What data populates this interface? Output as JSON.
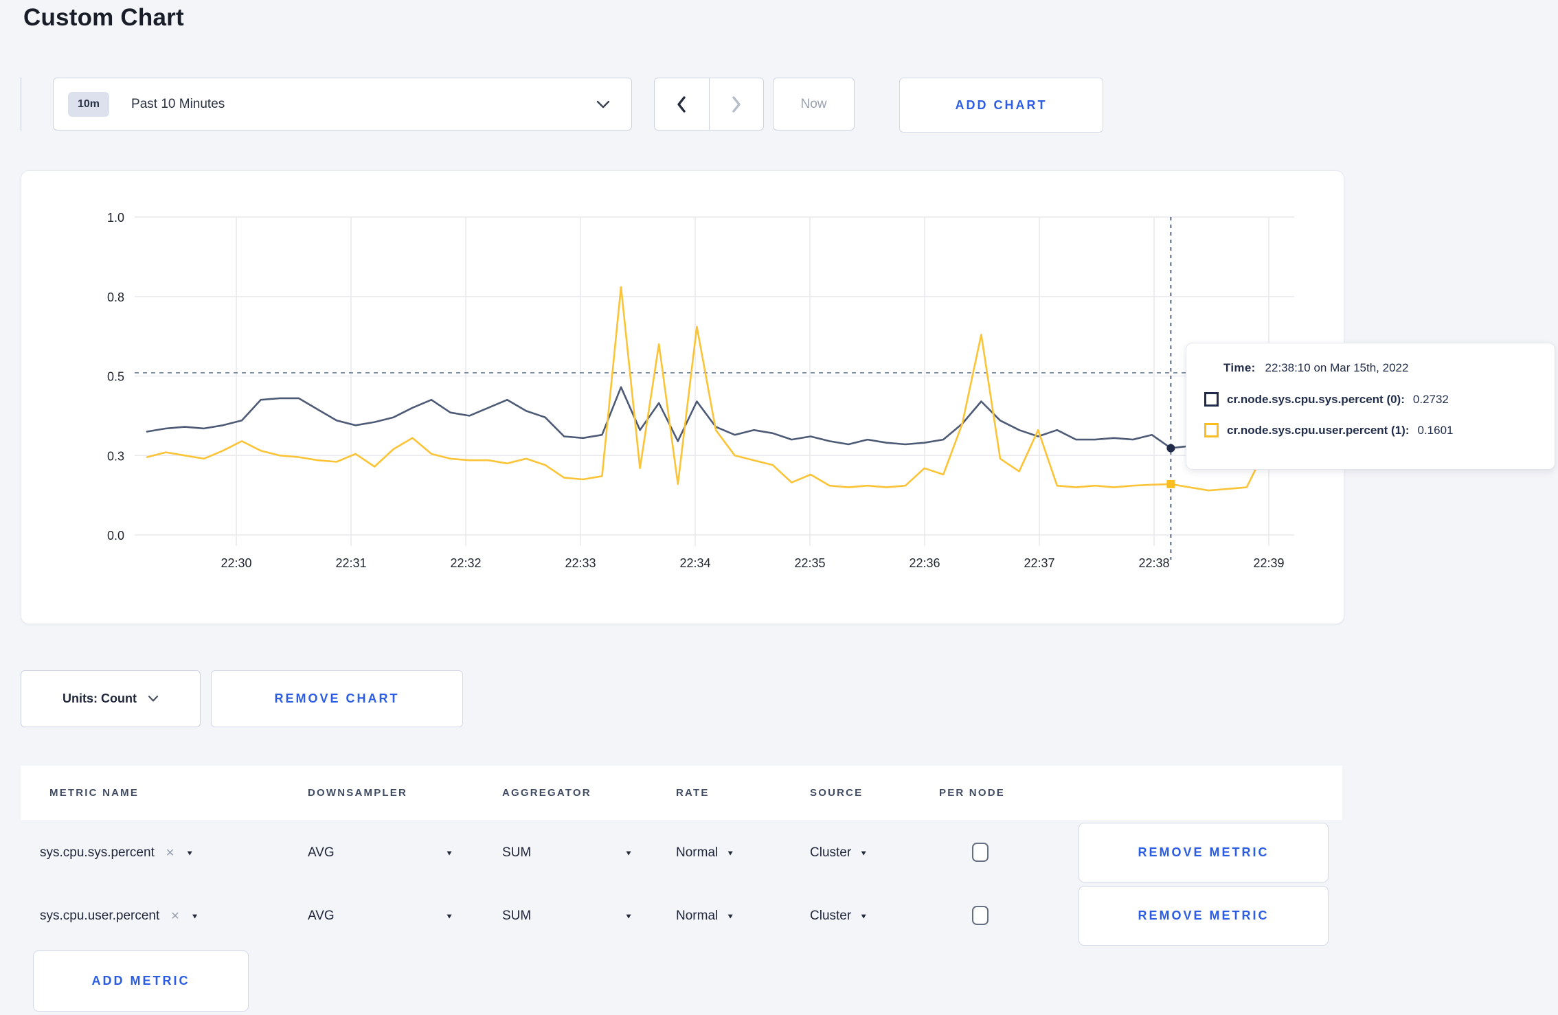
{
  "page": {
    "title": "Custom Chart",
    "accent_blue": "#2b5ce2",
    "background": "#f4f5f9"
  },
  "toolbar": {
    "time_range": {
      "badge": "10m",
      "label": "Past 10 Minutes"
    },
    "now_label": "Now",
    "add_chart_label": "ADD CHART"
  },
  "chart_data": {
    "type": "line",
    "title": "",
    "xlabel": "",
    "ylabel": "",
    "ylim": [
      0,
      1
    ],
    "grid": true,
    "x_start": "22:29:10",
    "interval_seconds": 10,
    "x_ticks": [
      "22:30",
      "22:31",
      "22:32",
      "22:33",
      "22:34",
      "22:35",
      "22:36",
      "22:37",
      "22:38",
      "22:39"
    ],
    "y_ticks": [
      {
        "v": 0,
        "label": "0.0"
      },
      {
        "v": 0.25,
        "label": "0.3"
      },
      {
        "v": 0.5,
        "label": "0.5"
      },
      {
        "v": 0.75,
        "label": "0.8"
      },
      {
        "v": 1,
        "label": "1.0"
      }
    ],
    "series": [
      {
        "name": "cr.node.sys.cpu.sys.percent",
        "color": "#4d5a76",
        "swatch_color": "#1f2b49",
        "marker": "circle",
        "values": [
          0.325,
          0.335,
          0.34,
          0.335,
          0.345,
          0.36,
          0.425,
          0.43,
          0.43,
          0.395,
          0.36,
          0.345,
          0.355,
          0.37,
          0.4,
          0.425,
          0.385,
          0.375,
          0.4,
          0.425,
          0.39,
          0.37,
          0.31,
          0.305,
          0.315,
          0.465,
          0.33,
          0.415,
          0.295,
          0.42,
          0.34,
          0.315,
          0.33,
          0.32,
          0.3,
          0.31,
          0.295,
          0.285,
          0.3,
          0.29,
          0.285,
          0.29,
          0.3,
          0.35,
          0.42,
          0.36,
          0.33,
          0.31,
          0.33,
          0.3,
          0.3,
          0.305,
          0.3,
          0.315,
          0.273,
          0.28,
          0.285,
          0.28,
          0.31,
          0.335,
          0.3
        ]
      },
      {
        "name": "cr.node.sys.cpu.user.percent",
        "color": "#fbc437",
        "swatch_color": "#fcbd1f",
        "marker": "square",
        "values": [
          0.245,
          0.26,
          0.25,
          0.24,
          0.265,
          0.295,
          0.265,
          0.25,
          0.245,
          0.235,
          0.23,
          0.255,
          0.215,
          0.27,
          0.305,
          0.255,
          0.24,
          0.235,
          0.235,
          0.225,
          0.24,
          0.22,
          0.18,
          0.175,
          0.185,
          0.78,
          0.21,
          0.6,
          0.16,
          0.655,
          0.33,
          0.25,
          0.235,
          0.22,
          0.165,
          0.19,
          0.155,
          0.15,
          0.155,
          0.15,
          0.155,
          0.21,
          0.19,
          0.35,
          0.63,
          0.24,
          0.2,
          0.33,
          0.155,
          0.15,
          0.155,
          0.15,
          0.155,
          0.158,
          0.16,
          0.15,
          0.14,
          0.145,
          0.15,
          0.27,
          0.23
        ]
      }
    ],
    "hover": {
      "index": 54,
      "time": "22:38:10",
      "guide_value": 0.51
    },
    "legend_position": "tooltip"
  },
  "tooltip": {
    "time_label": "Time:",
    "time_value": "22:38:10 on Mar 15th, 2022",
    "rows": [
      {
        "label": "cr.node.sys.cpu.sys.percent (0):",
        "value": "0.2732",
        "color": "#1f2b49"
      },
      {
        "label": "cr.node.sys.cpu.user.percent (1):",
        "value": "0.1601",
        "color": "#fcbd1f"
      }
    ]
  },
  "chart_controls": {
    "units_label": "Units: Count",
    "remove_chart_label": "REMOVE CHART"
  },
  "metrics_table": {
    "headers": [
      "METRIC NAME",
      "DOWNSAMPLER",
      "AGGREGATOR",
      "RATE",
      "SOURCE",
      "PER NODE"
    ],
    "rows": [
      {
        "metric": "sys.cpu.sys.percent",
        "downsampler": "AVG",
        "aggregator": "SUM",
        "rate": "Normal",
        "source": "Cluster",
        "per_node_checked": false,
        "remove_label": "REMOVE METRIC"
      },
      {
        "metric": "sys.cpu.user.percent",
        "downsampler": "AVG",
        "aggregator": "SUM",
        "rate": "Normal",
        "source": "Cluster",
        "per_node_checked": false,
        "remove_label": "REMOVE METRIC"
      }
    ],
    "add_metric_label": "ADD METRIC"
  }
}
